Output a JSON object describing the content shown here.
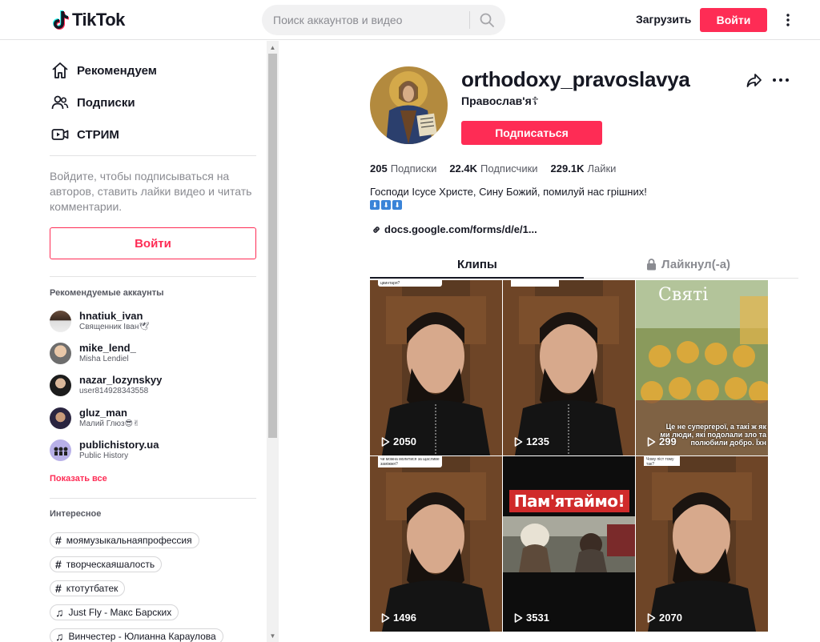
{
  "header": {
    "logo_text": "TikTok",
    "search_placeholder": "Поиск аккаунтов и видео",
    "upload_label": "Загрузить",
    "login_label": "Войти"
  },
  "sidebar": {
    "nav": [
      {
        "label": "Рекомендуем",
        "icon": "home-icon"
      },
      {
        "label": "Подписки",
        "icon": "following-icon"
      },
      {
        "label": "СТРИМ",
        "icon": "live-icon"
      }
    ],
    "login_hint": "Войдите, чтобы подписываться на авторов, ставить лайки видео и читать комментарии.",
    "login_button": "Войти",
    "recommended_title": "Рекомендуемые аккаунты",
    "accounts": [
      {
        "name": "hnatiuk_ivan",
        "sub": "Священник Іван🕊"
      },
      {
        "name": "mike_lend_",
        "sub": "Misha Lendiel"
      },
      {
        "name": "nazar_lozynskyy",
        "sub": "user814928343558"
      },
      {
        "name": "gluz_man",
        "sub": "Малий Глюз😎✌"
      },
      {
        "name": "publichistory.ua",
        "sub": "Public History"
      }
    ],
    "show_all": "Показать все",
    "discover_title": "Интересное",
    "tags": [
      {
        "type": "hashtag",
        "label": "моямузыкальнаяпрофессия"
      },
      {
        "type": "hashtag",
        "label": "творческаяшалость"
      },
      {
        "type": "hashtag",
        "label": "ктотутбатек"
      },
      {
        "type": "music",
        "label": "Just Fly - Макс Барских"
      },
      {
        "type": "music",
        "label": "Винчестер - Юлианна Караулова"
      }
    ]
  },
  "profile": {
    "username": "orthodoxy_pravoslavya",
    "nickname": "Православ'я☦",
    "follow_button": "Подписаться",
    "stats": [
      {
        "value": "205",
        "label": "Подписки"
      },
      {
        "value": "22.4K",
        "label": "Подписчики"
      },
      {
        "value": "229.1K",
        "label": "Лайки"
      }
    ],
    "bio": "Господи Ісусе Христе, Сину Божий, помилуй нас грішних!",
    "link": "docs.google.com/forms/d/e/1...",
    "tabs": {
      "videos": "Клипы",
      "liked": "Лайкнул(-а)"
    }
  },
  "videos": [
    {
      "views": "2050",
      "caption": "цвинтаря?"
    },
    {
      "views": "1235",
      "caption": ""
    },
    {
      "views": "299",
      "title": "Святі",
      "overlay": "Це не супергерої, а такі ж як ми люди, які подолали зло та полюбили добро. Їхн"
    },
    {
      "views": "1496",
      "caption": "чи можна молитися за щасливе заміжжя?"
    },
    {
      "views": "3531",
      "title": "Пам'ятаймо!"
    },
    {
      "views": "2070",
      "caption": "Чому піст тому так?"
    }
  ],
  "colors": {
    "accent": "#fe2c55",
    "text": "#161823",
    "muted": "#8a8b91"
  }
}
